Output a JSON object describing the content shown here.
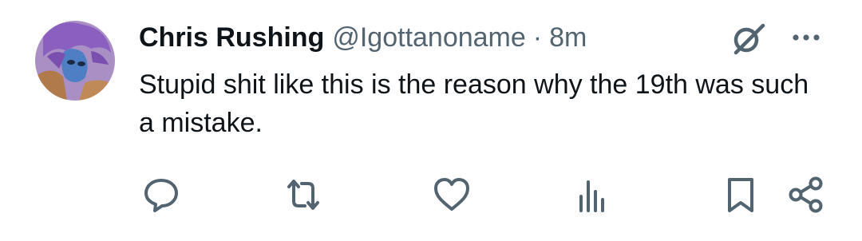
{
  "post": {
    "author_name": "Chris Rushing",
    "handle": "@Igottanoname",
    "separator": "·",
    "time": "8m",
    "text": "Stupid shit like this is the reason why the 19th was such a mistake."
  },
  "icons": {
    "avatar": "avatar-image",
    "grok": "grok-icon",
    "more": "more-dots-icon",
    "reply": "reply-icon",
    "repost": "repost-icon",
    "like": "heart-icon",
    "views": "views-bar-chart-icon",
    "bookmark": "bookmark-icon",
    "share": "share-icon"
  },
  "colors": {
    "text": "#0f1419",
    "secondary": "#536471",
    "icon": "#536471",
    "background": "#ffffff"
  }
}
